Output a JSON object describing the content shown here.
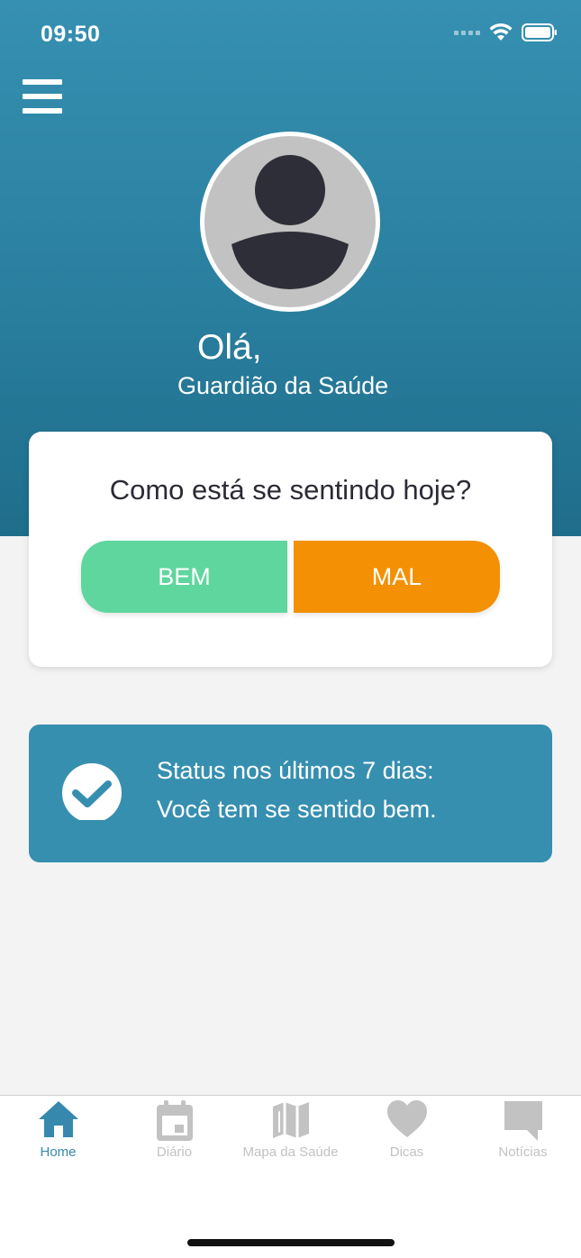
{
  "status_bar": {
    "time": "09:50"
  },
  "header": {
    "greeting": "Olá,",
    "username": "Guardião da Saúde"
  },
  "feeling_card": {
    "question": "Como está se sentindo hoje?",
    "good_label": "BEM",
    "bad_label": "MAL"
  },
  "status_card": {
    "line1": "Status nos últimos 7 dias:",
    "line2": "Você tem se sentido bem."
  },
  "tabs": [
    {
      "label": "Home",
      "icon": "home-icon",
      "active": true
    },
    {
      "label": "Diário",
      "icon": "calendar-icon",
      "active": false
    },
    {
      "label": "Mapa da Saúde",
      "icon": "map-icon",
      "active": false
    },
    {
      "label": "Dicas",
      "icon": "heart-icon",
      "active": false
    },
    {
      "label": "Notícias",
      "icon": "chat-bubble-icon",
      "active": false
    }
  ],
  "colors": {
    "header_blue": "#2a7f9f",
    "good_green": "#5fd69e",
    "bad_orange": "#f39003",
    "status_blue": "#378fb0",
    "tab_active": "#3689ad",
    "tab_inactive": "#c2c2c2"
  }
}
